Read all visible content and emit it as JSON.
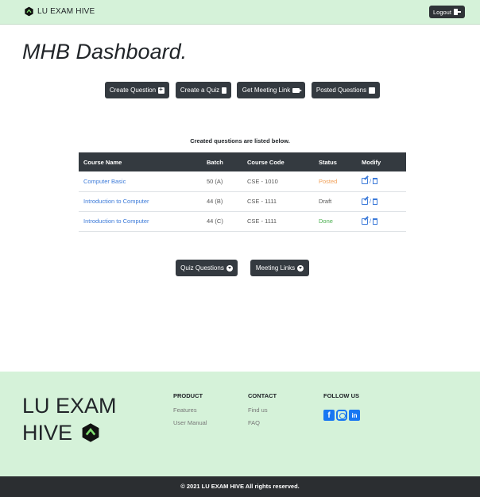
{
  "nav": {
    "brand": "LU EXAM HIVE",
    "logout_label": "Logout"
  },
  "page": {
    "title": "MHB Dashboard."
  },
  "actions": [
    {
      "label": "Create Question",
      "icon": "plus-square-icon"
    },
    {
      "label": "Create a Quiz",
      "icon": "document-icon"
    },
    {
      "label": "Get Meeting Link",
      "icon": "video-camera-icon"
    },
    {
      "label": "Posted Questions",
      "icon": "newspaper-icon"
    }
  ],
  "table": {
    "caption": "Created questions are listed below.",
    "headers": [
      "Course Name",
      "Batch",
      "Course Code",
      "Status",
      "Modify"
    ],
    "rows": [
      {
        "course": "Computer Basic",
        "batch": "50 (A)",
        "code": "CSE - 1010",
        "status": "Posted",
        "modify": "/"
      },
      {
        "course": "Introduction to Computer",
        "batch": "44 (B)",
        "code": "CSE - 1111",
        "status": "Draft",
        "modify": "/"
      },
      {
        "course": "Introduction to Computer",
        "batch": "44 (C)",
        "code": "CSE - 1111",
        "status": "Done",
        "modify": "/"
      }
    ]
  },
  "toggles": [
    {
      "label": "Quiz Questions",
      "icon": "chevron-down-circle-icon"
    },
    {
      "label": "Meeting Links",
      "icon": "chevron-down-circle-icon"
    }
  ],
  "footer": {
    "brand_line1": "LU EXAM",
    "brand_line2": "HIVE",
    "product_heading": "PRODUCT",
    "product_links": [
      "Features",
      "User Manual"
    ],
    "contact_heading": "CONTACT",
    "contact_links": [
      "Find us",
      "FAQ"
    ],
    "follow_heading": "FOLLOW US",
    "social": [
      "facebook-icon",
      "instagram-icon",
      "linkedin-icon"
    ],
    "copyright": "© 2021 LU EXAM HIVE All rights reserved."
  },
  "colors": {
    "mint": "#d5f2d9",
    "dark": "#343a40",
    "link": "#3d7bd9",
    "posted": "#f0a15a",
    "done": "#4caf50"
  }
}
